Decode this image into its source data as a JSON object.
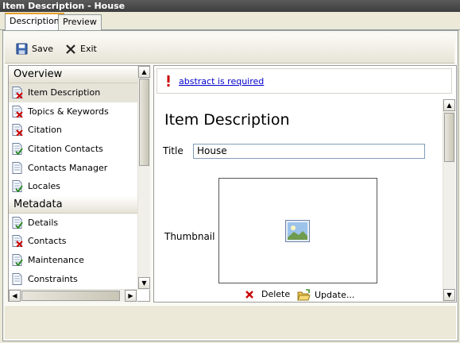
{
  "window": {
    "title": "Item Description - House"
  },
  "tabs": [
    {
      "label": "Description",
      "active": true
    },
    {
      "label": "Preview",
      "active": false
    }
  ],
  "toolbar": {
    "save_label": "Save",
    "exit_label": "Exit"
  },
  "sidebar": {
    "sections": [
      {
        "title": "Overview",
        "items": [
          {
            "label": "Item Description",
            "status": "error",
            "selected": true
          },
          {
            "label": "Topics & Keywords",
            "status": "error"
          },
          {
            "label": "Citation",
            "status": "error"
          },
          {
            "label": "Citation Contacts",
            "status": "ok"
          },
          {
            "label": "Contacts Manager",
            "status": "neutral"
          },
          {
            "label": "Locales",
            "status": "ok"
          }
        ]
      },
      {
        "title": "Metadata",
        "items": [
          {
            "label": "Details",
            "status": "ok"
          },
          {
            "label": "Contacts",
            "status": "error"
          },
          {
            "label": "Maintenance",
            "status": "ok"
          },
          {
            "label": "Constraints",
            "status": "neutral"
          }
        ]
      }
    ]
  },
  "validation": {
    "message": "abstract is required",
    "icon": "exclamation-icon"
  },
  "main": {
    "heading": "Item Description",
    "title_label": "Title",
    "title_value": "House",
    "thumbnail_label": "Thumbnail",
    "delete_label": "Delete",
    "update_label": "Update..."
  },
  "colors": {
    "titlebar": "#4a4a4a",
    "tab_accent": "#e6a02a",
    "link": "#0000cc",
    "error": "#cc0000"
  }
}
